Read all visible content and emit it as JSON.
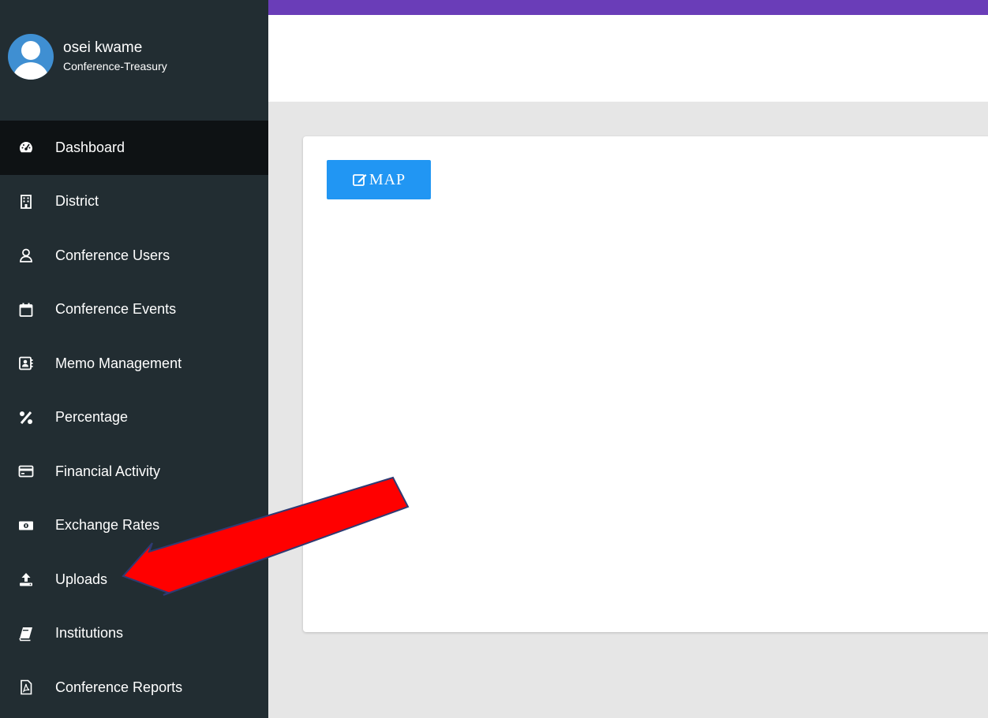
{
  "user": {
    "name": "osei kwame",
    "role": "Conference-Treasury"
  },
  "menu": [
    {
      "label": "Dashboard",
      "icon": "tachometer-icon",
      "active": true
    },
    {
      "label": "District",
      "icon": "building-icon",
      "active": false
    },
    {
      "label": "Conference Users",
      "icon": "user-icon",
      "active": false
    },
    {
      "label": "Conference Events",
      "icon": "calendar-icon",
      "active": false
    },
    {
      "label": "Memo Management",
      "icon": "address-card-icon",
      "active": false
    },
    {
      "label": "Percentage",
      "icon": "percent-icon",
      "active": false
    },
    {
      "label": "Financial Activity",
      "icon": "credit-card-icon",
      "active": false
    },
    {
      "label": "Exchange Rates",
      "icon": "money-bill-icon",
      "active": false
    },
    {
      "label": "Uploads",
      "icon": "upload-icon",
      "active": false
    },
    {
      "label": "Institutions",
      "icon": "book-icon",
      "active": false
    },
    {
      "label": "Conference Reports",
      "icon": "file-pdf-icon",
      "active": false
    }
  ],
  "main": {
    "map_button_label": "MAP"
  },
  "colors": {
    "sidebar_bg": "#222d32",
    "sidebar_active": "#0e1214",
    "topbar": "#6a3db8",
    "button": "#2196f3",
    "arrow": "#ff0000"
  }
}
